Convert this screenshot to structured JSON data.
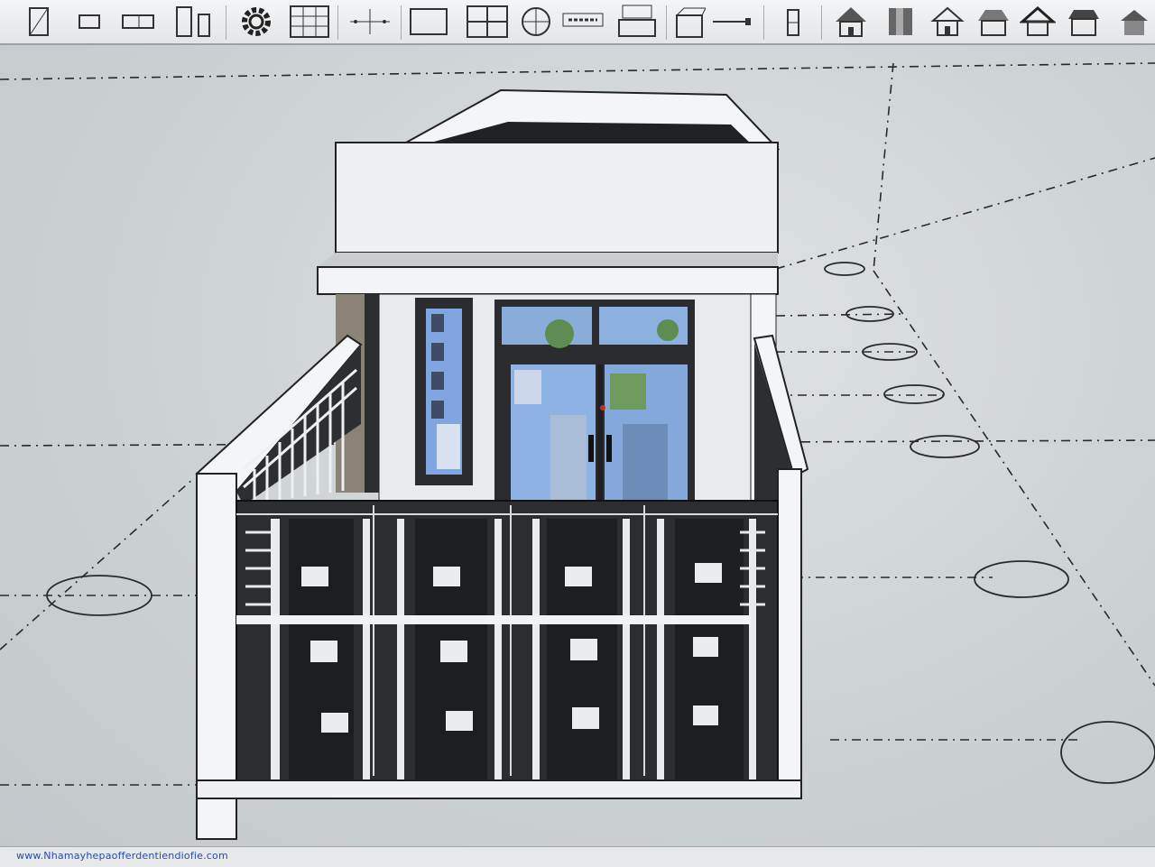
{
  "toolbar": {
    "tools": [
      {
        "icon": "wall-icon"
      },
      {
        "icon": "door-icon"
      },
      {
        "icon": "window-icon"
      },
      {
        "icon": "column-icon"
      },
      {
        "icon": "gear-icon"
      },
      {
        "icon": "grid-table-icon"
      },
      {
        "icon": "dimension-icon"
      },
      {
        "icon": "rectangle-icon"
      },
      {
        "icon": "panel-icon"
      },
      {
        "icon": "section-circle-icon"
      },
      {
        "icon": "text-label-icon"
      },
      {
        "icon": "stairs-icon"
      },
      {
        "icon": "object-icon"
      },
      {
        "icon": "line-icon"
      },
      {
        "icon": "lock-icon"
      },
      {
        "icon": "house-gable-icon"
      },
      {
        "icon": "box-icon"
      },
      {
        "icon": "house-icon"
      },
      {
        "icon": "house-hip-icon"
      },
      {
        "icon": "house-outline-icon"
      },
      {
        "icon": "house-flat-roof-icon"
      },
      {
        "icon": "house-small-icon"
      }
    ]
  },
  "status_bar": {
    "text": "www.Nhamayhepaofferdentiendiofie.com"
  },
  "colors": {
    "canvas": "#cfd3d6",
    "wall_white": "#f2f4f5",
    "gate_dark": "#2b2e31",
    "glass_blue": "#7fa6e0",
    "grid_line": "#2a2a2a"
  }
}
